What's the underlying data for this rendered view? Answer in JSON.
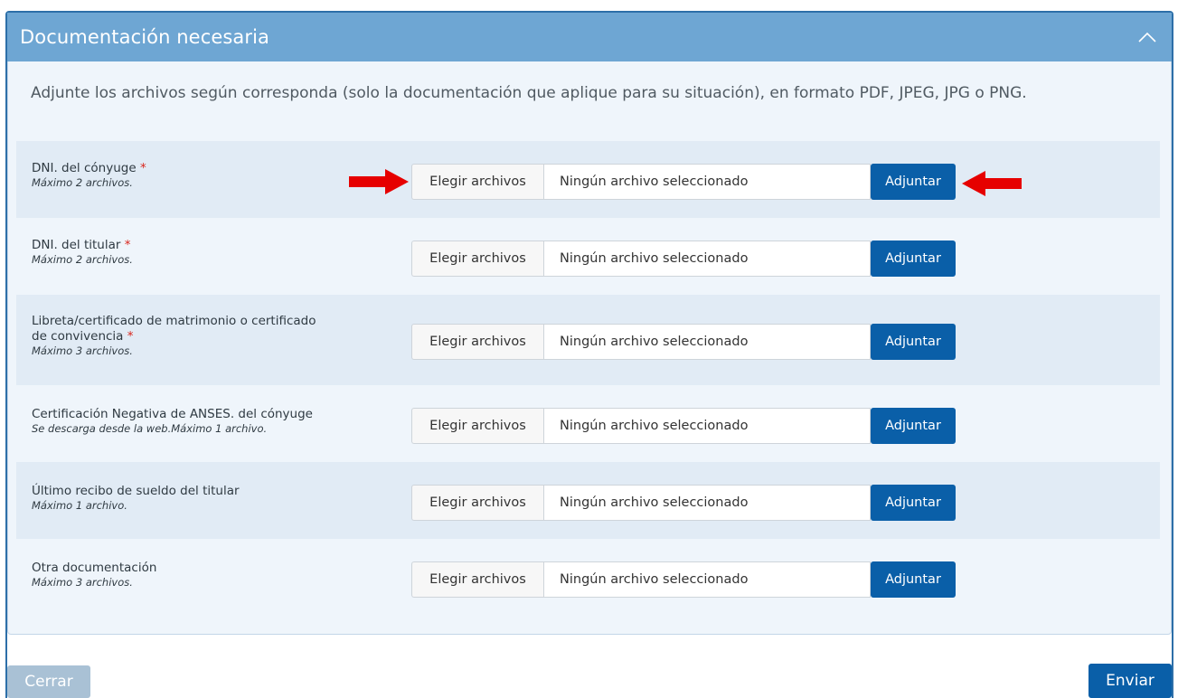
{
  "panel": {
    "title": "Documentación necesaria",
    "collapse_icon": "chevron-up-icon",
    "intro": "Adjunte los archivos según corresponda (solo la documentación que aplique para su situación), en formato PDF, JPEG, JPG o PNG."
  },
  "colors": {
    "header_bg": "#6ea6d3",
    "accent": "#0a5fa8",
    "required": "#d9261c",
    "arrow": "#e60000"
  },
  "required_mark": "*",
  "documents": [
    {
      "label": "DNI. del cónyuge",
      "label_line2": "",
      "required": true,
      "note": "Máximo 2 archivos.",
      "choose_label": "Elegir archivos",
      "file_status": "Ningún archivo seleccionado",
      "attach_label": "Adjuntar"
    },
    {
      "label": "DNI. del titular",
      "label_line2": "",
      "required": true,
      "note": "Máximo 2 archivos.",
      "choose_label": "Elegir archivos",
      "file_status": "Ningún archivo seleccionado",
      "attach_label": "Adjuntar"
    },
    {
      "label": "Libreta/certificado de matrimonio o certificado",
      "label_line2": "de convivencia",
      "required": true,
      "note": "Máximo 3 archivos.",
      "choose_label": "Elegir archivos",
      "file_status": "Ningún archivo seleccionado",
      "attach_label": "Adjuntar"
    },
    {
      "label": "Certificación Negativa de ANSES. del cónyuge",
      "label_line2": "",
      "required": false,
      "note": "Se descarga desde la web.Máximo 1 archivo.",
      "choose_label": "Elegir archivos",
      "file_status": "Ningún archivo seleccionado",
      "attach_label": "Adjuntar"
    },
    {
      "label": "Último recibo de sueldo del titular",
      "label_line2": "",
      "required": false,
      "note": "Máximo 1 archivo.",
      "choose_label": "Elegir archivos",
      "file_status": "Ningún archivo seleccionado",
      "attach_label": "Adjuntar"
    },
    {
      "label": "Otra documentación",
      "label_line2": "",
      "required": false,
      "note": "Máximo 3 archivos.",
      "choose_label": "Elegir archivos",
      "file_status": "Ningún archivo seleccionado",
      "attach_label": "Adjuntar"
    }
  ],
  "footer": {
    "close_label": "Cerrar",
    "submit_label": "Enviar"
  }
}
